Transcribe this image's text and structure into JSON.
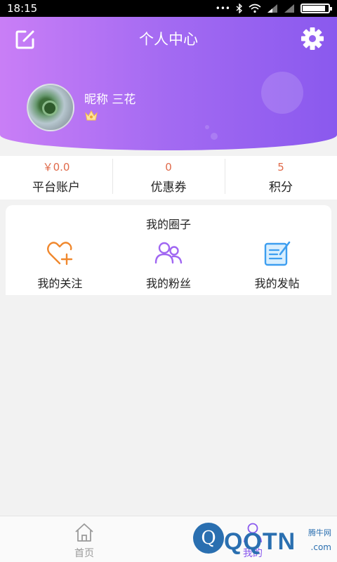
{
  "status_bar": {
    "time": "18:15",
    "battery_level": 0.85
  },
  "header": {
    "title": "个人中心"
  },
  "profile": {
    "nickname": "昵称 三花"
  },
  "stats": [
    {
      "value": "￥0.0",
      "label": "平台账户"
    },
    {
      "value": "0",
      "label": "优惠券"
    },
    {
      "value": "5",
      "label": "积分"
    }
  ],
  "circle": {
    "title": "我的圈子",
    "items": [
      {
        "label": "我的关注",
        "icon": "heart-plus-icon"
      },
      {
        "label": "我的粉丝",
        "icon": "users-icon"
      },
      {
        "label": "我的发帖",
        "icon": "post-edit-icon"
      }
    ]
  },
  "tabs": [
    {
      "label": "首页",
      "icon": "home-icon"
    },
    {
      "label": "我的",
      "icon": "person-icon"
    }
  ],
  "watermark": {
    "logo_text": "Q",
    "brand": "QQTN",
    "site_label": "腾牛网",
    "domain": ".com"
  },
  "colors": {
    "accent_purple": "#8a59ee",
    "header_gradient_start": "#c97ef6",
    "value_red": "#e06a4a"
  }
}
